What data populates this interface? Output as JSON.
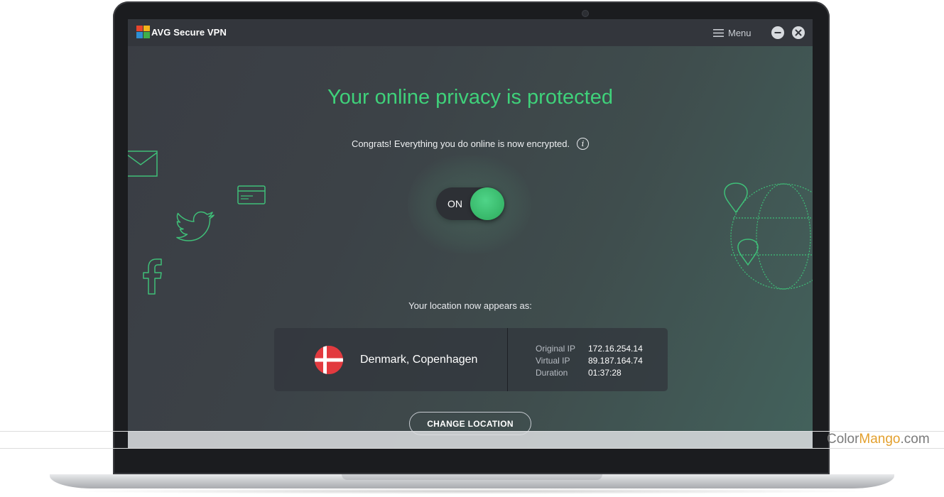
{
  "app": {
    "title": "Secure VPN",
    "logo_text": "AVG",
    "menu_label": "Menu",
    "menu_icon": "hamburger-icon",
    "minimize_icon": "minimize-icon",
    "close_icon": "close-icon"
  },
  "main": {
    "headline": "Your online privacy is protected",
    "subline": "Congrats! Everything you do online is now encrypted.",
    "info_icon_glyph": "i",
    "toggle": {
      "label": "ON",
      "state": "on"
    },
    "location_caption": "Your location now appears as:",
    "location": {
      "flag": "denmark-flag",
      "country": "Denmark, Copenhagen",
      "rows": [
        {
          "key": "Original IP",
          "value": "172.16.254.14"
        },
        {
          "key": "Virtual IP",
          "value": "89.187.164.74"
        },
        {
          "key": "Duration",
          "value": "01:37:28"
        }
      ]
    },
    "change_button": "CHANGE LOCATION"
  },
  "decorations": [
    "mail-icon",
    "credit-card-icon",
    "twitter-icon",
    "facebook-icon",
    "globe-pins-icon"
  ],
  "watermark": {
    "part1": "Color",
    "part2": "Mango",
    "part3": ".com"
  },
  "colors": {
    "accent_green": "#3fd17a",
    "flag_red": "#e23a3f",
    "deco_green": "#3fbf78"
  }
}
